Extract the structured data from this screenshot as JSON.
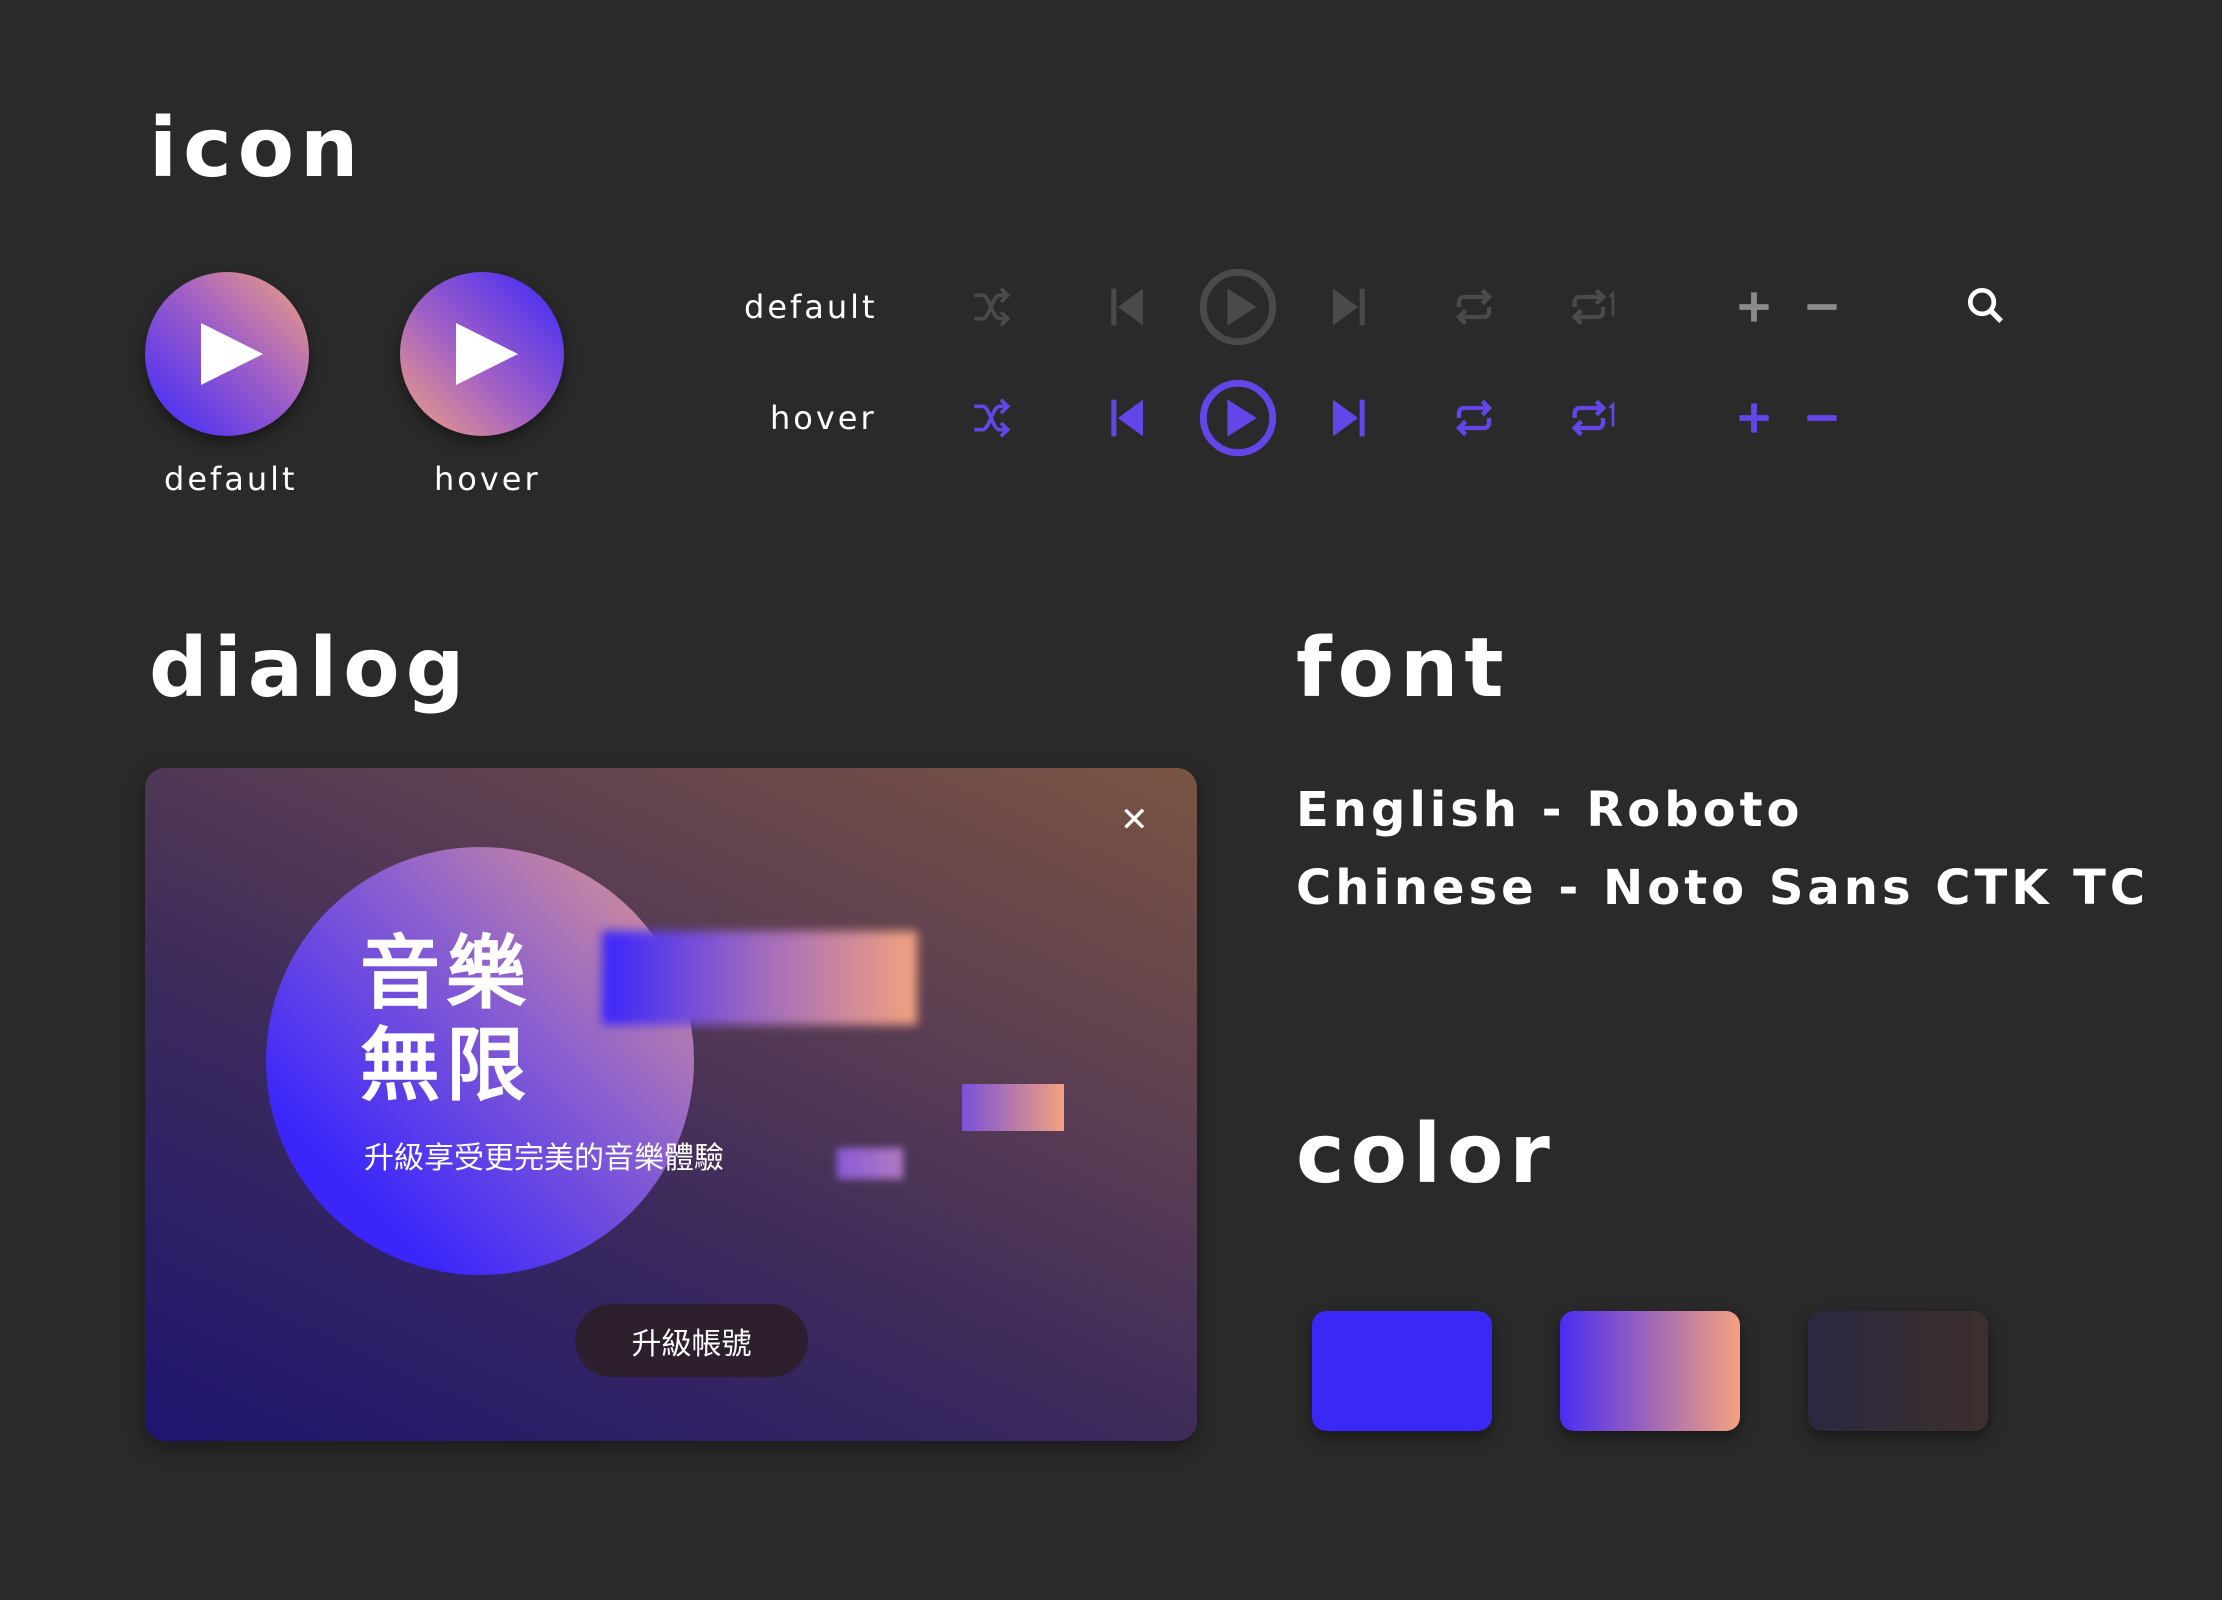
{
  "sections": {
    "icon": "icon",
    "dialog": "dialog",
    "font": "font",
    "color": "color"
  },
  "big_play": {
    "default_label": "default",
    "hover_label": "hover"
  },
  "icon_rows": {
    "default_label": "default",
    "hover_label": "hover",
    "default_color": "#4a4a4a",
    "default_pm_color": "#8a8a8a",
    "hover_color": "#6446e8",
    "search_color": "#ffffff"
  },
  "dialog": {
    "title_line1": "音樂",
    "title_line2": "無限",
    "subtitle": "升級享受更完美的音樂體驗",
    "button": "升級帳號",
    "close": "✕"
  },
  "fonts": {
    "english": "English - Roboto",
    "chinese": "Chinese - Noto Sans CTK TC"
  },
  "colors": {
    "primary": "#3a28f7",
    "gradient_start": "#4a2cf2",
    "gradient_end": "#f4a27f",
    "dark_start": "#2b2842",
    "dark_end": "#3d302c"
  }
}
